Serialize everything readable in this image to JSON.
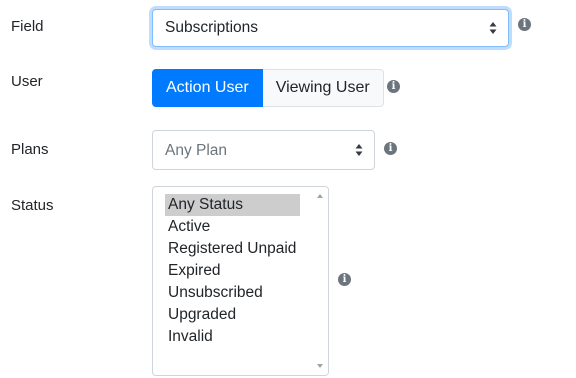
{
  "fields": {
    "field": {
      "label": "Field",
      "value": "Subscriptions"
    },
    "user": {
      "label": "User",
      "options": [
        "Action User",
        "Viewing User"
      ],
      "active_option": "Action User"
    },
    "plans": {
      "label": "Plans",
      "value": "Any Plan"
    },
    "status": {
      "label": "Status",
      "options": [
        "Any Status",
        "Active",
        "Registered Unpaid",
        "Expired",
        "Unsubscribed",
        "Upgraded",
        "Invalid"
      ],
      "selected_option": "Any Status"
    }
  },
  "icons": {
    "info": "info-circle-icon",
    "select_caret": "up-down-caret-icon",
    "scroll_up": "triangle-up-icon",
    "scroll_down": "triangle-down-icon"
  },
  "colors": {
    "accent": "#007bff",
    "focus_border": "#80bdff",
    "selected_item_bg": "#cdcdcd",
    "icon_gray": "#6c757d"
  }
}
